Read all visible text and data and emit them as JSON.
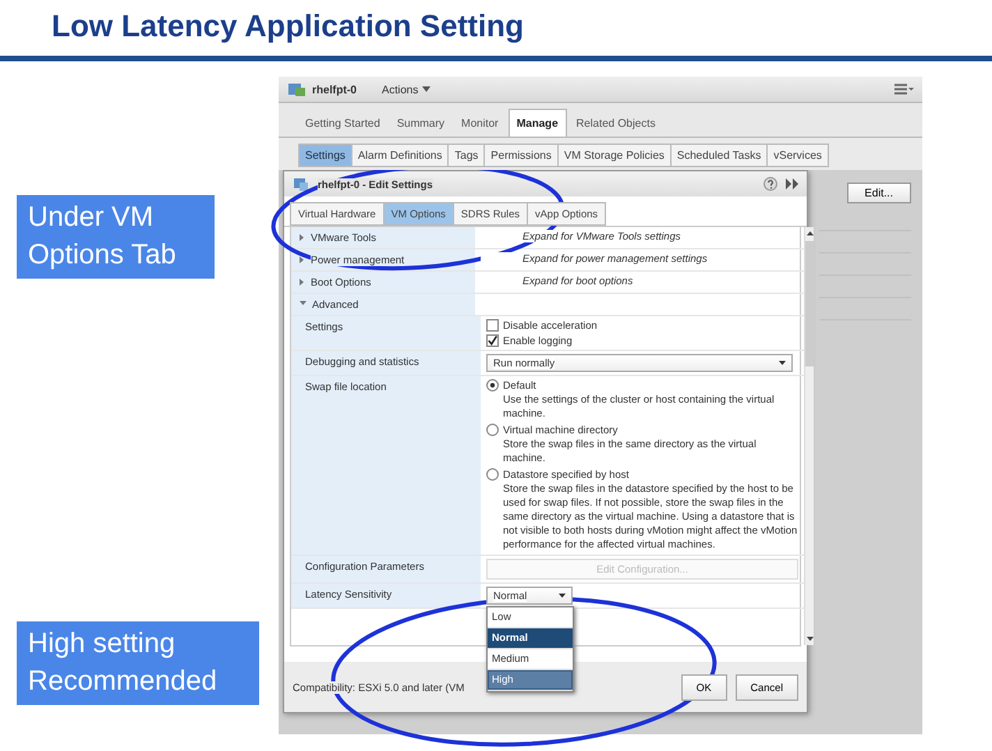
{
  "slide_title": "Low Latency Application Setting",
  "callouts": [
    {
      "text": "Under VM Options Tab"
    },
    {
      "text": "High setting Recommended"
    }
  ],
  "screenshot": {
    "object_name": "rhelfpt-0",
    "actions_menu": "Actions",
    "tabs": [
      {
        "label": "Getting Started",
        "selected": false
      },
      {
        "label": "Summary",
        "selected": false
      },
      {
        "label": "Monitor",
        "selected": false
      },
      {
        "label": "Manage",
        "selected": true
      },
      {
        "label": "Related Objects",
        "selected": false
      }
    ],
    "subtabs": [
      {
        "label": "Settings",
        "selected": true
      },
      {
        "label": "Alarm Definitions",
        "selected": false
      },
      {
        "label": "Tags",
        "selected": false
      },
      {
        "label": "Permissions",
        "selected": false
      },
      {
        "label": "VM Storage Policies",
        "selected": false
      },
      {
        "label": "Scheduled Tasks",
        "selected": false
      },
      {
        "label": "vServices",
        "selected": false
      }
    ],
    "edit_button": "Edit...",
    "dialog": {
      "title": "rhelfpt-0 - Edit Settings",
      "tabs": [
        {
          "label": "Virtual Hardware",
          "selected": false
        },
        {
          "label": "VM Options",
          "selected": true
        },
        {
          "label": "SDRS Rules",
          "selected": false
        },
        {
          "label": "vApp Options",
          "selected": false
        }
      ],
      "rows": [
        {
          "kind": "group",
          "label": "VMware Tools",
          "value": "Expand for VMware Tools settings",
          "expanded": false
        },
        {
          "kind": "group",
          "label": "Power management",
          "value": "Expand for power management settings",
          "expanded": false
        },
        {
          "kind": "group",
          "label": "Boot Options",
          "value": "Expand for boot options",
          "expanded": false
        },
        {
          "kind": "group",
          "label": "Advanced",
          "expanded": true
        },
        {
          "kind": "checkboxes",
          "label": "Settings",
          "options": [
            {
              "label": "Disable acceleration",
              "checked": false
            },
            {
              "label": "Enable logging",
              "checked": true
            }
          ]
        },
        {
          "kind": "select",
          "label": "Debugging and statistics",
          "value": "Run normally"
        },
        {
          "kind": "radios",
          "label": "Swap file location",
          "options": [
            {
              "label": "Default",
              "description": "Use the settings of the cluster or host containing the virtual machine.",
              "selected": true
            },
            {
              "label": "Virtual machine directory",
              "description": "Store the swap files in the same directory as the virtual machine.",
              "selected": false
            },
            {
              "label": "Datastore specified by host",
              "description": "Store the swap files in the datastore specified by the host to be used for swap files. If not possible, store the swap files in the same directory as the virtual machine. Using a datastore that is not visible to both hosts during vMotion might affect the vMotion performance for the affected virtual machines.",
              "selected": false
            }
          ]
        },
        {
          "kind": "button",
          "label": "Configuration Parameters",
          "button": "Edit Configuration...",
          "disabled": true
        },
        {
          "kind": "select_open",
          "label": "Latency Sensitivity",
          "value": "Normal",
          "options": [
            {
              "label": "Low",
              "selected": false,
              "hovered": false
            },
            {
              "label": "Normal",
              "selected": true,
              "hovered": false
            },
            {
              "label": "Medium",
              "selected": false,
              "hovered": false
            },
            {
              "label": "High",
              "selected": false,
              "hovered": true
            }
          ]
        }
      ],
      "compatibility": "Compatibility: ESXi 5.0 and later (VM",
      "buttons": [
        "OK",
        "Cancel"
      ]
    }
  }
}
